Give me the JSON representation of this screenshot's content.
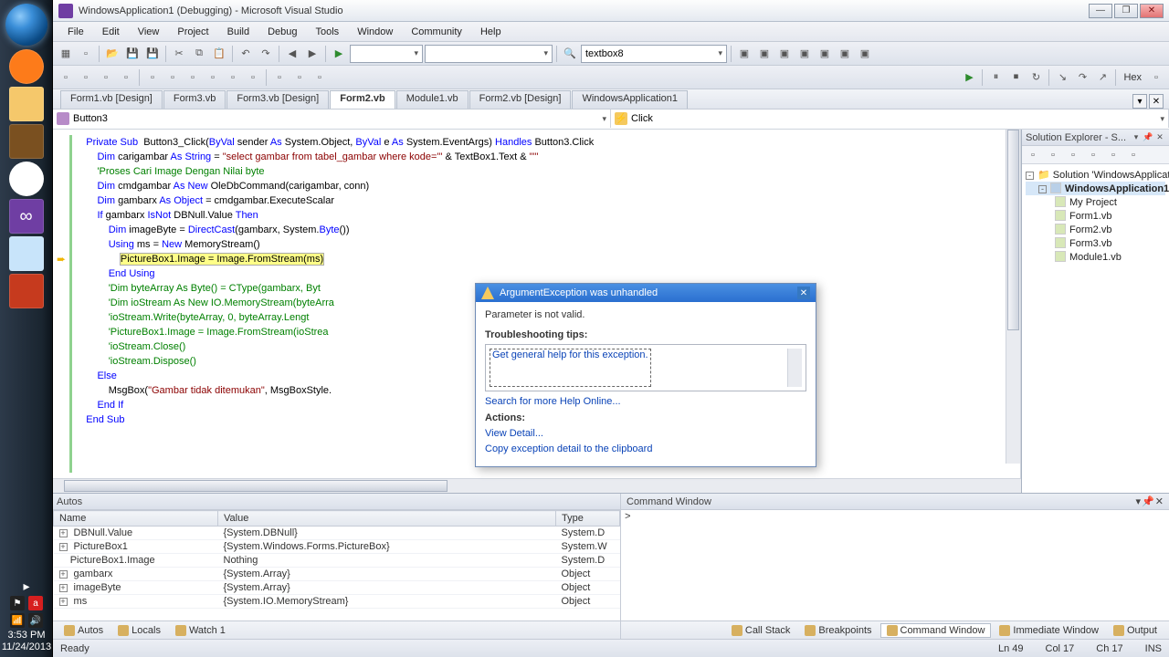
{
  "titlebar": {
    "text": "WindowsApplication1 (Debugging) - Microsoft Visual Studio"
  },
  "menu": [
    "File",
    "Edit",
    "View",
    "Project",
    "Build",
    "Debug",
    "Tools",
    "Window",
    "Community",
    "Help"
  ],
  "combo": {
    "find": "textbox8"
  },
  "hex": "Hex",
  "doctabs": [
    "Form1.vb [Design]",
    "Form3.vb",
    "Form3.vb [Design]",
    "Form2.vb",
    "Module1.vb",
    "Form2.vb [Design]",
    "WindowsApplication1"
  ],
  "doctab_active": 3,
  "member": {
    "left": "Button3",
    "right": "Click"
  },
  "code": [
    {
      "t": "Private Sub Button3_Click(ByVal sender As System.Object, ByVal e As System.EventArgs) Handles Button3.Click",
      "cls": [
        [
          "kw",
          "Private Sub"
        ],
        [
          "",
          "  Button3_Click("
        ],
        [
          "kw",
          "ByVal"
        ],
        [
          "",
          " sender "
        ],
        [
          "kw",
          "As"
        ],
        [
          "",
          " System.Object, "
        ],
        [
          "kw",
          "ByVal"
        ],
        [
          "",
          " e "
        ],
        [
          "kw",
          "As"
        ],
        [
          "",
          " System.EventArgs) "
        ],
        [
          "kw",
          "Handles"
        ],
        [
          "",
          " Button3.Click"
        ]
      ]
    },
    {
      "i": 1,
      "cls": [
        [
          "kw",
          "Dim"
        ],
        [
          "",
          " carigambar "
        ],
        [
          "kw",
          "As String"
        ],
        [
          "",
          " = "
        ],
        [
          "str",
          "\"select gambar from tabel_gambar where kode='\""
        ],
        [
          "",
          " & TextBox1.Text & "
        ],
        [
          "str",
          "\"'\""
        ]
      ]
    },
    {
      "i": 1,
      "cls": [
        [
          "cm",
          "'Proses Cari Image Dengan Nilai byte"
        ]
      ]
    },
    {
      "i": 1,
      "cls": [
        [
          "kw",
          "Dim"
        ],
        [
          "",
          " cmdgambar "
        ],
        [
          "kw",
          "As New"
        ],
        [
          "",
          " OleDbCommand(carigambar, conn)"
        ]
      ]
    },
    {
      "i": 1,
      "cls": [
        [
          "kw",
          "Dim"
        ],
        [
          "",
          " gambarx "
        ],
        [
          "kw",
          "As Object"
        ],
        [
          "",
          " = cmdgambar.ExecuteScalar"
        ]
      ]
    },
    {
      "i": 1,
      "cls": [
        [
          "kw",
          "If"
        ],
        [
          "",
          " gambarx "
        ],
        [
          "kw",
          "IsNot"
        ],
        [
          "",
          " DBNull.Value "
        ],
        [
          "kw",
          "Then"
        ]
      ]
    },
    {
      "i": 2,
      "cls": [
        [
          "kw",
          "Dim"
        ],
        [
          "",
          " imageByte = "
        ],
        [
          "kw",
          "DirectCast"
        ],
        [
          "",
          "(gambarx, System."
        ],
        [
          "kw",
          "Byte"
        ],
        [
          "",
          "())"
        ]
      ]
    },
    {
      "i": 2,
      "cls": [
        [
          "kw",
          "Using"
        ],
        [
          "",
          " ms = "
        ],
        [
          "kw",
          "New"
        ],
        [
          "",
          " MemoryStream()"
        ]
      ]
    },
    {
      "i": 3,
      "hl": true,
      "cls": [
        [
          "",
          "PictureBox1.Image = Image.FromStream(ms)"
        ]
      ]
    },
    {
      "i": 2,
      "cls": [
        [
          "kw",
          "End Using"
        ]
      ]
    },
    {
      "i": 2,
      "cls": [
        [
          "cm",
          "'Dim byteArray As Byte() = CType(gambarx, Byt"
        ]
      ]
    },
    {
      "i": 2,
      "cls": [
        [
          "cm",
          "'Dim ioStream As New IO.MemoryStream(byteArra"
        ]
      ]
    },
    {
      "i": 2,
      "cls": [
        [
          "cm",
          "'ioStream.Write(byteArray, 0, byteArray.Lengt"
        ]
      ]
    },
    {
      "i": 2,
      "cls": [
        [
          "cm",
          "'PictureBox1.Image = Image.FromStream(ioStrea"
        ]
      ]
    },
    {
      "i": 2,
      "cls": [
        [
          "cm",
          "'ioStream.Close()"
        ]
      ]
    },
    {
      "i": 2,
      "cls": [
        [
          "cm",
          "'ioStream.Dispose()"
        ]
      ]
    },
    {
      "i": 1,
      "cls": [
        [
          "kw",
          "Else"
        ]
      ]
    },
    {
      "i": 2,
      "cls": [
        [
          "",
          "MsgBox("
        ],
        [
          "str",
          "\"Gambar tidak ditemukan\""
        ],
        [
          "",
          ", MsgBoxStyle."
        ]
      ]
    },
    {
      "i": 1,
      "cls": [
        [
          "kw",
          "End If"
        ]
      ]
    },
    {
      "i": 0,
      "cls": [
        [
          "kw",
          "End Sub"
        ]
      ]
    }
  ],
  "exc": {
    "title": "ArgumentException was unhandled",
    "msg": "Parameter is not valid.",
    "tips_label": "Troubleshooting tips:",
    "tip_link": "Get general help for this exception.",
    "search": "Search for more Help Online...",
    "actions_label": "Actions:",
    "view_detail": "View Detail...",
    "copy": "Copy exception detail to the clipboard"
  },
  "solex": {
    "title": "Solution Explorer - S...",
    "root": "Solution 'WindowsApplicat",
    "project": "WindowsApplication1",
    "items": [
      "My Project",
      "Form1.vb",
      "Form2.vb",
      "Form3.vb",
      "Module1.vb"
    ]
  },
  "autos": {
    "title": "Autos",
    "cols": [
      "Name",
      "Value",
      "Type"
    ],
    "rows": [
      {
        "n": "DBNull.Value",
        "v": "{System.DBNull}",
        "t": "System.D",
        "e": true
      },
      {
        "n": "PictureBox1",
        "v": "{System.Windows.Forms.PictureBox}",
        "t": "System.W",
        "e": true
      },
      {
        "n": "PictureBox1.Image",
        "v": "Nothing",
        "t": "System.D",
        "e": false
      },
      {
        "n": "gambarx",
        "v": "{System.Array}",
        "t": "Object",
        "e": true
      },
      {
        "n": "imageByte",
        "v": "{System.Array}",
        "t": "Object",
        "e": true
      },
      {
        "n": "ms",
        "v": "{System.IO.MemoryStream}",
        "t": "Object",
        "e": true
      }
    ],
    "tabs": [
      "Autos",
      "Locals",
      "Watch 1"
    ]
  },
  "cmdwin": {
    "title": "Command Window",
    "prompt": ">"
  },
  "rtabs": [
    "Call Stack",
    "Breakpoints",
    "Command Window",
    "Immediate Window",
    "Output"
  ],
  "rtab_active": 2,
  "status": {
    "ready": "Ready",
    "ln": "Ln 49",
    "col": "Col 17",
    "ch": "Ch 17",
    "ins": "INS"
  },
  "clock": {
    "time": "3:53 PM",
    "date": "11/24/2013"
  }
}
